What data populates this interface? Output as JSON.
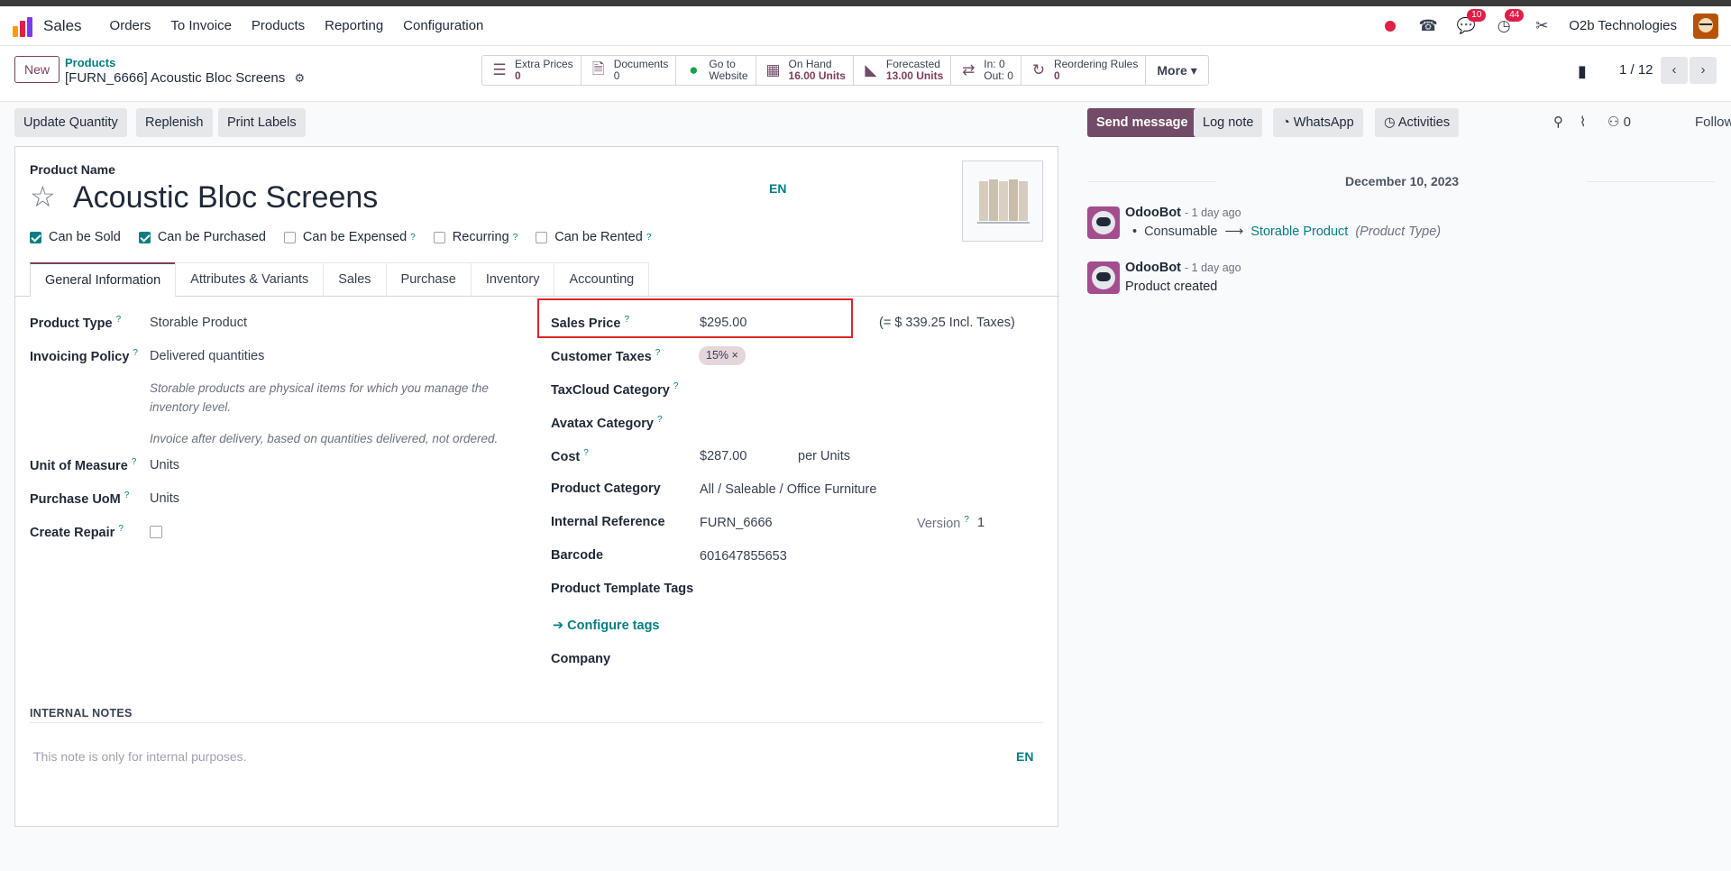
{
  "navbar": {
    "app_name": "Sales",
    "menu": [
      "Orders",
      "To Invoice",
      "Products",
      "Reporting",
      "Configuration"
    ],
    "messages_badge": "10",
    "activities_badge": "44",
    "company": "O2b Technologies"
  },
  "control_panel": {
    "new_label": "New",
    "breadcrumb_parent": "Products",
    "breadcrumb_current": "[FURN_6666] Acoustic Bloc Screens",
    "smart_buttons": {
      "extra_prices": {
        "title": "Extra Prices",
        "value": "0"
      },
      "documents": {
        "title": "Documents",
        "value": "0"
      },
      "website": {
        "title": "Go to",
        "value": "Website"
      },
      "on_hand": {
        "title": "On Hand",
        "value": "16.00 Units"
      },
      "forecasted": {
        "title": "Forecasted",
        "value": "13.00 Units"
      },
      "in_out": {
        "title": "In: 0",
        "value": "Out: 0"
      },
      "reordering": {
        "title": "Reordering Rules",
        "value": "0"
      },
      "more": "More ▾"
    },
    "pager": "1 / 12"
  },
  "actions": {
    "update_quantity": "Update Quantity",
    "replenish": "Replenish",
    "print_labels": "Print Labels"
  },
  "form": {
    "product_name_label": "Product Name",
    "product_name": "Acoustic Bloc Screens",
    "lang": "EN",
    "checkboxes": {
      "can_be_sold": {
        "label": "Can be Sold",
        "checked": true
      },
      "can_be_purchased": {
        "label": "Can be Purchased",
        "checked": true
      },
      "can_be_expensed": {
        "label": "Can be Expensed",
        "checked": false
      },
      "recurring": {
        "label": "Recurring",
        "checked": false
      },
      "can_be_rented": {
        "label": "Can be Rented",
        "checked": false
      }
    },
    "tabs": [
      "General Information",
      "Attributes & Variants",
      "Sales",
      "Purchase",
      "Inventory",
      "Accounting"
    ],
    "left": {
      "product_type_label": "Product Type",
      "product_type": "Storable Product",
      "invoicing_policy_label": "Invoicing Policy",
      "invoicing_policy": "Delivered quantities",
      "hint1": "Storable products are physical items for which you manage the inventory level.",
      "hint2": "Invoice after delivery, based on quantities delivered, not ordered.",
      "uom_label": "Unit of Measure",
      "uom": "Units",
      "purchase_uom_label": "Purchase UoM",
      "purchase_uom": "Units",
      "create_repair_label": "Create Repair"
    },
    "right": {
      "sales_price_label": "Sales Price",
      "sales_price": "$295.00",
      "incl_taxes": "(= $ 339.25 Incl. Taxes)",
      "customer_taxes_label": "Customer Taxes",
      "customer_tax_tag": "15% ×",
      "taxcloud_label": "TaxCloud Category",
      "avatax_label": "Avatax Category",
      "cost_label": "Cost",
      "cost": "$287.00",
      "cost_unit": "per Units",
      "category_label": "Product Category",
      "category": "All / Saleable / Office Furniture",
      "internal_ref_label": "Internal Reference",
      "internal_ref": "FURN_6666",
      "version_label": "Version",
      "version": "1",
      "barcode_label": "Barcode",
      "barcode": "601647855653",
      "template_tags_label": "Product Template Tags",
      "configure_tags": "➔  Configure tags",
      "company_label": "Company"
    },
    "notes": {
      "title": "INTERNAL NOTES",
      "placeholder": "This note is only for internal purposes.",
      "lang": "EN"
    }
  },
  "chatter": {
    "send_message": "Send message",
    "log_note": "Log note",
    "whatsapp": "WhatsApp",
    "activities": "Activities",
    "followers_count": "0",
    "follow": "Follow",
    "date": "December 10, 2023",
    "messages": [
      {
        "author": "OdooBot",
        "ago": "- 1 day ago",
        "old": "Consumable",
        "arrow": "⟶",
        "new": "Storable Product",
        "field": "(Product Type)"
      },
      {
        "author": "OdooBot",
        "ago": "- 1 day ago",
        "body": "Product created"
      }
    ]
  },
  "colors": {
    "brand": "#714b67",
    "link": "#017e84",
    "highlight": "#dc2626"
  }
}
